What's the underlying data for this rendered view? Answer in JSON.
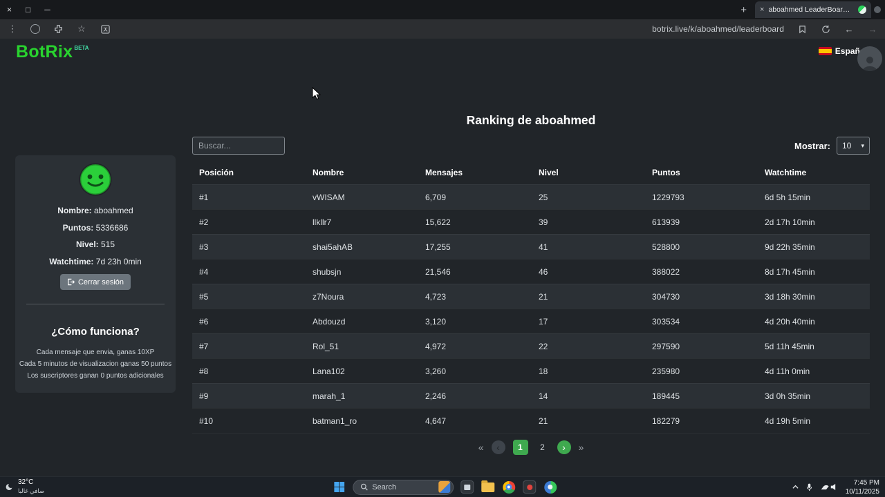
{
  "browser": {
    "tab_title": "aboahmed LeaderBoard | The",
    "url": "botrix.live/k/aboahmed/leaderboard"
  },
  "header": {
    "logo": "BotRix",
    "beta": "BETA",
    "language": "Español"
  },
  "page": {
    "heading": "Ranking de aboahmed",
    "search_placeholder": "Buscar...",
    "show_label": "Mostrar:",
    "show_value": "10"
  },
  "profile": {
    "name_label": "Nombre:",
    "name": "aboahmed",
    "points_label": "Puntos:",
    "points": "5336686",
    "level_label": "Nivel:",
    "level": "515",
    "watchtime_label": "Watchtime:",
    "watchtime": "7d 23h 0min",
    "logout": "Cerrar sesión",
    "how_title": "¿Cómo funciona?",
    "how_lines": [
      "Cada mensaje que envia, ganas 10XP",
      "Cada 5 minutos de visualizacion ganas 50 puntos",
      "Los suscriptores ganan 0 puntos adicionales"
    ]
  },
  "table": {
    "headers": [
      "Posición",
      "Nombre",
      "Mensajes",
      "Nivel",
      "Puntos",
      "Watchtime"
    ],
    "rows": [
      [
        "#1",
        "vWISAM",
        "6,709",
        "25",
        "1229793",
        "6d 5h 15min"
      ],
      [
        "#2",
        "llkllr7",
        "15,622",
        "39",
        "613939",
        "2d 17h 10min"
      ],
      [
        "#3",
        "shai5ahAB",
        "17,255",
        "41",
        "528800",
        "9d 22h 35min"
      ],
      [
        "#4",
        "shubsjn",
        "21,546",
        "46",
        "388022",
        "8d 17h 45min"
      ],
      [
        "#5",
        "z7Noura",
        "4,723",
        "21",
        "304730",
        "3d 18h 30min"
      ],
      [
        "#6",
        "Abdouzd",
        "3,120",
        "17",
        "303534",
        "4d 20h 40min"
      ],
      [
        "#7",
        "Rol_51",
        "4,972",
        "22",
        "297590",
        "5d 11h 45min"
      ],
      [
        "#8",
        "Lana102",
        "3,260",
        "18",
        "235980",
        "4d 11h 0min"
      ],
      [
        "#9",
        "marah_1",
        "2,246",
        "14",
        "189445",
        "3d 0h 35min"
      ],
      [
        "#10",
        "batman1_ro",
        "4,647",
        "21",
        "182279",
        "4d 19h 5min"
      ]
    ]
  },
  "pagination": {
    "pages": [
      "1",
      "2"
    ]
  },
  "taskbar": {
    "weather_temp": "32°C",
    "weather_desc": "صافي غالبا",
    "search_label": "Search",
    "time": "7:45 PM",
    "date": "10/11/2025"
  },
  "colors": {
    "brand_green": "#29d32f",
    "active_green": "#3fa94f",
    "flag_red": "#c60b1e",
    "flag_yellow": "#ffc400"
  }
}
